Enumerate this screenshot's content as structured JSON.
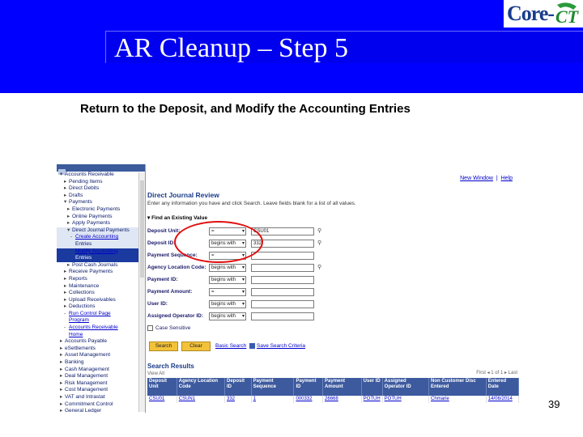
{
  "slide": {
    "title": "AR Cleanup – Step 5",
    "subtitle": "Return to the Deposit, and Modify the Accounting Entries",
    "page_number": "39",
    "logo_text": "Core-",
    "logo_mark_text": "CT",
    "colors": {
      "header_blue": "#0000ff",
      "title_box_blue": "#0000ee",
      "highlight_red": "#e01010"
    }
  },
  "menu": {
    "items": [
      {
        "label": "Accounts Receivable",
        "level": 1,
        "arrow": "▾"
      },
      {
        "label": "Pending Items",
        "level": 2,
        "arrow": "▸"
      },
      {
        "label": "Direct Debits",
        "level": 2,
        "arrow": "▸"
      },
      {
        "label": "Drafts",
        "level": 2,
        "arrow": "▸"
      },
      {
        "label": "Payments",
        "level": 2,
        "arrow": "▾"
      },
      {
        "label": "Electronic Payments",
        "level": 3,
        "arrow": "▸"
      },
      {
        "label": "Online Payments",
        "level": 3,
        "arrow": "▸"
      },
      {
        "label": "Apply Payments",
        "level": 3,
        "arrow": "▸"
      },
      {
        "label": "Direct Journal Payments",
        "level": 3,
        "arrow": "▾"
      },
      {
        "label": "Create Accounting",
        "level": 4,
        "arrow": "-"
      },
      {
        "label": "Entries",
        "level": 4,
        "arrow": ""
      },
      {
        "label": "Modify Accounting",
        "level": 4,
        "arrow": "-"
      },
      {
        "label": "Entries",
        "level": 4,
        "arrow": ""
      },
      {
        "label": "Post Cash Journals",
        "level": 3,
        "arrow": "▸"
      },
      {
        "label": "Receive Payments",
        "level": 2,
        "arrow": "▸"
      },
      {
        "label": "Reports",
        "level": 2,
        "arrow": "▸"
      },
      {
        "label": "Maintenance",
        "level": 2,
        "arrow": "▸"
      },
      {
        "label": "Collections",
        "level": 2,
        "arrow": "▸"
      },
      {
        "label": "Upload Receivables",
        "level": 2,
        "arrow": "▸"
      },
      {
        "label": "Deductions",
        "level": 2,
        "arrow": "▸"
      },
      {
        "label": "Run Control Page",
        "level": 2,
        "arrow": "-"
      },
      {
        "label": "Program",
        "level": 2,
        "arrow": ""
      },
      {
        "label": "Accounts Receivable",
        "level": 2,
        "arrow": "-"
      },
      {
        "label": "Home",
        "level": 2,
        "arrow": ""
      },
      {
        "label": "Accounts Payable",
        "level": 1,
        "arrow": "▸"
      },
      {
        "label": "eSettlements",
        "level": 1,
        "arrow": "▸"
      },
      {
        "label": "Asset Management",
        "level": 1,
        "arrow": "▸"
      },
      {
        "label": "Banking",
        "level": 1,
        "arrow": "▸"
      },
      {
        "label": "Cash Management",
        "level": 1,
        "arrow": "▸"
      },
      {
        "label": "Deal Management",
        "level": 1,
        "arrow": "▸"
      },
      {
        "label": "Risk Management",
        "level": 1,
        "arrow": "▸"
      },
      {
        "label": "Cost Management",
        "level": 1,
        "arrow": "▸"
      },
      {
        "label": "VAT and Intrastat",
        "level": 1,
        "arrow": "▸"
      },
      {
        "label": "Commitment Control",
        "level": 1,
        "arrow": "▸"
      },
      {
        "label": "General Ledger",
        "level": 1,
        "arrow": "▸"
      },
      {
        "label": "Allocations",
        "level": 1,
        "arrow": "▸"
      }
    ]
  },
  "content": {
    "top_links": {
      "new_window": "New Window",
      "help": "Help"
    },
    "page_title": "Direct Journal Review",
    "instructions": "Enter any information you have and click Search. Leave fields blank for a list of all values.",
    "find_tab": "Find an Existing Value",
    "fields": [
      {
        "label": "Deposit Unit:",
        "operator": "=",
        "value": "CSU01"
      },
      {
        "label": "Deposit ID:",
        "operator": "begins with",
        "value": "332"
      },
      {
        "label": "Payment Sequence:",
        "operator": "=",
        "value": ""
      },
      {
        "label": "Agency Location Code:",
        "operator": "begins with",
        "value": ""
      },
      {
        "label": "Payment ID:",
        "operator": "begins with",
        "value": ""
      },
      {
        "label": "Payment Amount:",
        "operator": "=",
        "value": ""
      },
      {
        "label": "User ID:",
        "operator": "begins with",
        "value": ""
      },
      {
        "label": "Assigned Operator ID:",
        "operator": "begins with",
        "value": ""
      }
    ],
    "case_sensitive": "Case Sensitive",
    "buttons": {
      "search": "Search",
      "clear": "Clear"
    },
    "basic_search": "Basic Search",
    "save_criteria": "Save Search Criteria",
    "results": {
      "title": "Search Results",
      "view": "View All",
      "nav": "First  ◂  1 of 1  ▸  Last",
      "columns": [
        "Deposit Unit",
        "Agency Location Code",
        "Deposit ID",
        "Payment Sequence",
        "Payment ID",
        "Payment Amount",
        "User ID",
        "Assigned Operator ID",
        "Non Customer Disc Entered",
        "Entered Date"
      ],
      "rows": [
        [
          "CSU01",
          "CSUN1",
          "332",
          "1",
          "000332",
          "26668",
          "POTUH",
          "POTUH",
          "Chmarie",
          "14/06/2014"
        ]
      ]
    }
  }
}
